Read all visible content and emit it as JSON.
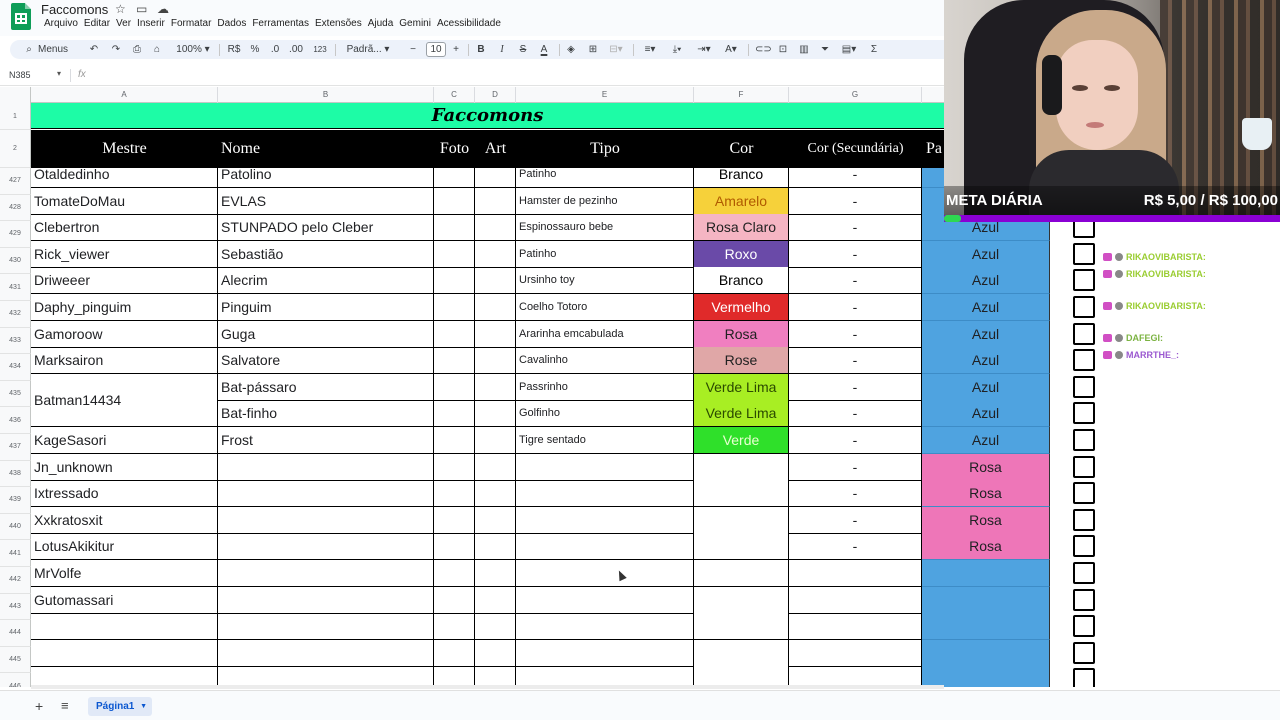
{
  "app": {
    "doc_title": "Faccomons",
    "menu": [
      "Arquivo",
      "Editar",
      "Ver",
      "Inserir",
      "Formatar",
      "Dados",
      "Ferramentas",
      "Extensões",
      "Ajuda",
      "Gemini",
      "Acessibilidade"
    ]
  },
  "toolbar": {
    "search_label": "Menus",
    "zoom": "100%",
    "currency": "R$",
    "percent": "%",
    "dec_less": ".0",
    "dec_more": ".00",
    "number_format": "123",
    "font": "Padrã...",
    "font_size": "10",
    "minus": "−",
    "plus": "+"
  },
  "formula_bar": {
    "cell_ref": "N385",
    "fx": "fx"
  },
  "columns": [
    "A",
    "B",
    "C",
    "D",
    "E",
    "F",
    "G"
  ],
  "sheet": {
    "title": "Faccomons",
    "headers": {
      "mestre": "Mestre",
      "nome": "Nome",
      "foto": "Foto",
      "art": "Art",
      "tipo": "Tipo",
      "cor": "Cor",
      "cor_sec": "Cor (Secundária)",
      "pa": "Pa"
    },
    "row_numbers": [
      "1",
      "2",
      "427",
      "428",
      "429",
      "430",
      "431",
      "432",
      "433",
      "434",
      "435",
      "436",
      "437",
      "438",
      "439",
      "440",
      "441",
      "442",
      "443",
      "444",
      "445",
      "446"
    ],
    "rows": [
      {
        "mestre": "Otaldedinho",
        "nome": "Patolino",
        "tipo": "Patinho",
        "cor": "Branco",
        "cor_bg": "#ffffff",
        "cor_fg": "#000000",
        "sec": "-",
        "pa": "",
        "pa_bg": "#4fa3e0"
      },
      {
        "mestre": "TomateDoMau",
        "nome": "EVLAS",
        "tipo": "Hamster de pezinho",
        "cor": "Amarelo",
        "cor_bg": "#f6d13a",
        "cor_fg": "#b05a00",
        "sec": "-",
        "pa": "",
        "pa_bg": "#4fa3e0"
      },
      {
        "mestre": "Clebertron",
        "nome": " STUNPADO pelo Cleber",
        "tipo": "Espinossauro bebe",
        "cor": "Rosa Claro",
        "cor_bg": "#f5b5c3",
        "cor_fg": "#222222",
        "sec": "-",
        "pa": "Azul",
        "pa_bg": "#4fa3e0"
      },
      {
        "mestre": "Rick_viewer",
        "nome": "Sebastião",
        "tipo": "Patinho",
        "cor": "Roxo",
        "cor_bg": "#6a4aa8",
        "cor_fg": "#ffffff",
        "sec": "-",
        "pa": "Azul",
        "pa_bg": "#4fa3e0"
      },
      {
        "mestre": "Driweeer",
        "nome": "Alecrim",
        "tipo": "Ursinho toy",
        "cor": "Branco",
        "cor_bg": "#ffffff",
        "cor_fg": "#000000",
        "sec": "-",
        "pa": "Azul",
        "pa_bg": "#4fa3e0"
      },
      {
        "mestre": "Daphy_pinguim",
        "nome": "Pinguim",
        "tipo": "Coelho Totoro",
        "cor": "Vermelho",
        "cor_bg": "#e02a2a",
        "cor_fg": "#ffffff",
        "sec": "-",
        "pa": "Azul",
        "pa_bg": "#4fa3e0"
      },
      {
        "mestre": "Gamoroow",
        "nome": "Guga",
        "tipo": "Ararinha emcabulada",
        "cor": "Rosa",
        "cor_bg": "#f07fc0",
        "cor_fg": "#222222",
        "sec": "-",
        "pa": "Azul",
        "pa_bg": "#4fa3e0"
      },
      {
        "mestre": "Marksairon",
        "nome": "Salvatore",
        "tipo": "Cavalinho",
        "cor": "Rose",
        "cor_bg": "#e0a7a7",
        "cor_fg": "#222222",
        "sec": "-",
        "pa": "Azul",
        "pa_bg": "#4fa3e0"
      },
      {
        "mestre": "Batman14434",
        "nome": "Bat-pássaro",
        "tipo": "Passrinho",
        "cor": "Verde Lima",
        "cor_bg": "#a8ee23",
        "cor_fg": "#2b4a00",
        "sec": "-",
        "pa": "Azul",
        "pa_bg": "#4fa3e0"
      },
      {
        "mestre": "",
        "nome": "Bat-finho",
        "tipo": "Golfinho",
        "cor": "Verde Lima",
        "cor_bg": "#a8ee23",
        "cor_fg": "#2b4a00",
        "sec": "-",
        "pa": "Azul",
        "pa_bg": "#4fa3e0"
      },
      {
        "mestre": "KageSasori",
        "nome": "Frost",
        "tipo": "Tigre sentado",
        "cor": "Verde",
        "cor_bg": "#2fe02a",
        "cor_fg": "#e8ffd0",
        "sec": "-",
        "pa": "Azul",
        "pa_bg": "#4fa3e0"
      },
      {
        "mestre": "Jn_unknown",
        "nome": "",
        "tipo": "",
        "cor": "",
        "cor_bg": "#ffffff",
        "cor_fg": "#000000",
        "sec": "-",
        "pa": "Rosa",
        "pa_bg": "#ee76b8"
      },
      {
        "mestre": "Ixtressado",
        "nome": "",
        "tipo": "",
        "cor": "",
        "cor_bg": "#ffffff",
        "cor_fg": "#000000",
        "sec": "-",
        "pa": "Rosa",
        "pa_bg": "#ee76b8"
      },
      {
        "mestre": "Xxkratosxit",
        "nome": "",
        "tipo": "",
        "cor": "",
        "cor_bg": "#ffffff",
        "cor_fg": "#000000",
        "sec": "-",
        "pa": "Rosa",
        "pa_bg": "#ee76b8"
      },
      {
        "mestre": "LotusAkikitur",
        "nome": "",
        "tipo": "",
        "cor": "",
        "cor_bg": "#ffffff",
        "cor_fg": "#000000",
        "sec": "-",
        "pa": "Rosa",
        "pa_bg": "#ee76b8"
      },
      {
        "mestre": "MrVolfe",
        "nome": "",
        "tipo": "",
        "cor": "",
        "cor_bg": "#ffffff",
        "cor_fg": "#000000",
        "sec": "",
        "pa": "",
        "pa_bg": "#4fa3e0"
      },
      {
        "mestre": "Gutomassari",
        "nome": "",
        "tipo": "",
        "cor": "",
        "cor_bg": "#ffffff",
        "cor_fg": "#000000",
        "sec": "",
        "pa": "",
        "pa_bg": "#4fa3e0"
      },
      {
        "mestre": "",
        "nome": "",
        "tipo": "",
        "cor": "",
        "cor_bg": "#ffffff",
        "cor_fg": "#000000",
        "sec": "",
        "pa": "",
        "pa_bg": "#4fa3e0"
      },
      {
        "mestre": "",
        "nome": "",
        "tipo": "",
        "cor": "",
        "cor_bg": "#ffffff",
        "cor_fg": "#000000",
        "sec": "",
        "pa": "",
        "pa_bg": "#4fa3e0"
      },
      {
        "mestre": "",
        "nome": "",
        "tipo": "",
        "cor": "",
        "cor_bg": "#ffffff",
        "cor_fg": "#000000",
        "sec": "",
        "pa": "",
        "pa_bg": "#4fa3e0"
      }
    ]
  },
  "chat": [
    {
      "user": "RIKAOVIBARISTA:",
      "color": "#9acd32"
    },
    {
      "user": "RIKAOVIBARISTA:",
      "color": "#9acd32"
    },
    {
      "user": "RIKAOVIBARISTA:",
      "color": "#9acd32"
    },
    {
      "user": "DAFEGI:",
      "color": "#7cb342"
    },
    {
      "user": "MARRTHE_:",
      "color": "#9b59d0"
    }
  ],
  "webcam": {
    "meta_label": "META DIÁRIA",
    "meta_value": "R$ 5,00 / R$ 100,00",
    "meta_progress": 0.05
  },
  "tabs": {
    "sheet_name": "Página1"
  },
  "colors": {
    "title_bg": "#1dfca6",
    "header_bg": "#000000",
    "blue_fill": "#4fa3e0",
    "pink_fill": "#ee76b8"
  }
}
